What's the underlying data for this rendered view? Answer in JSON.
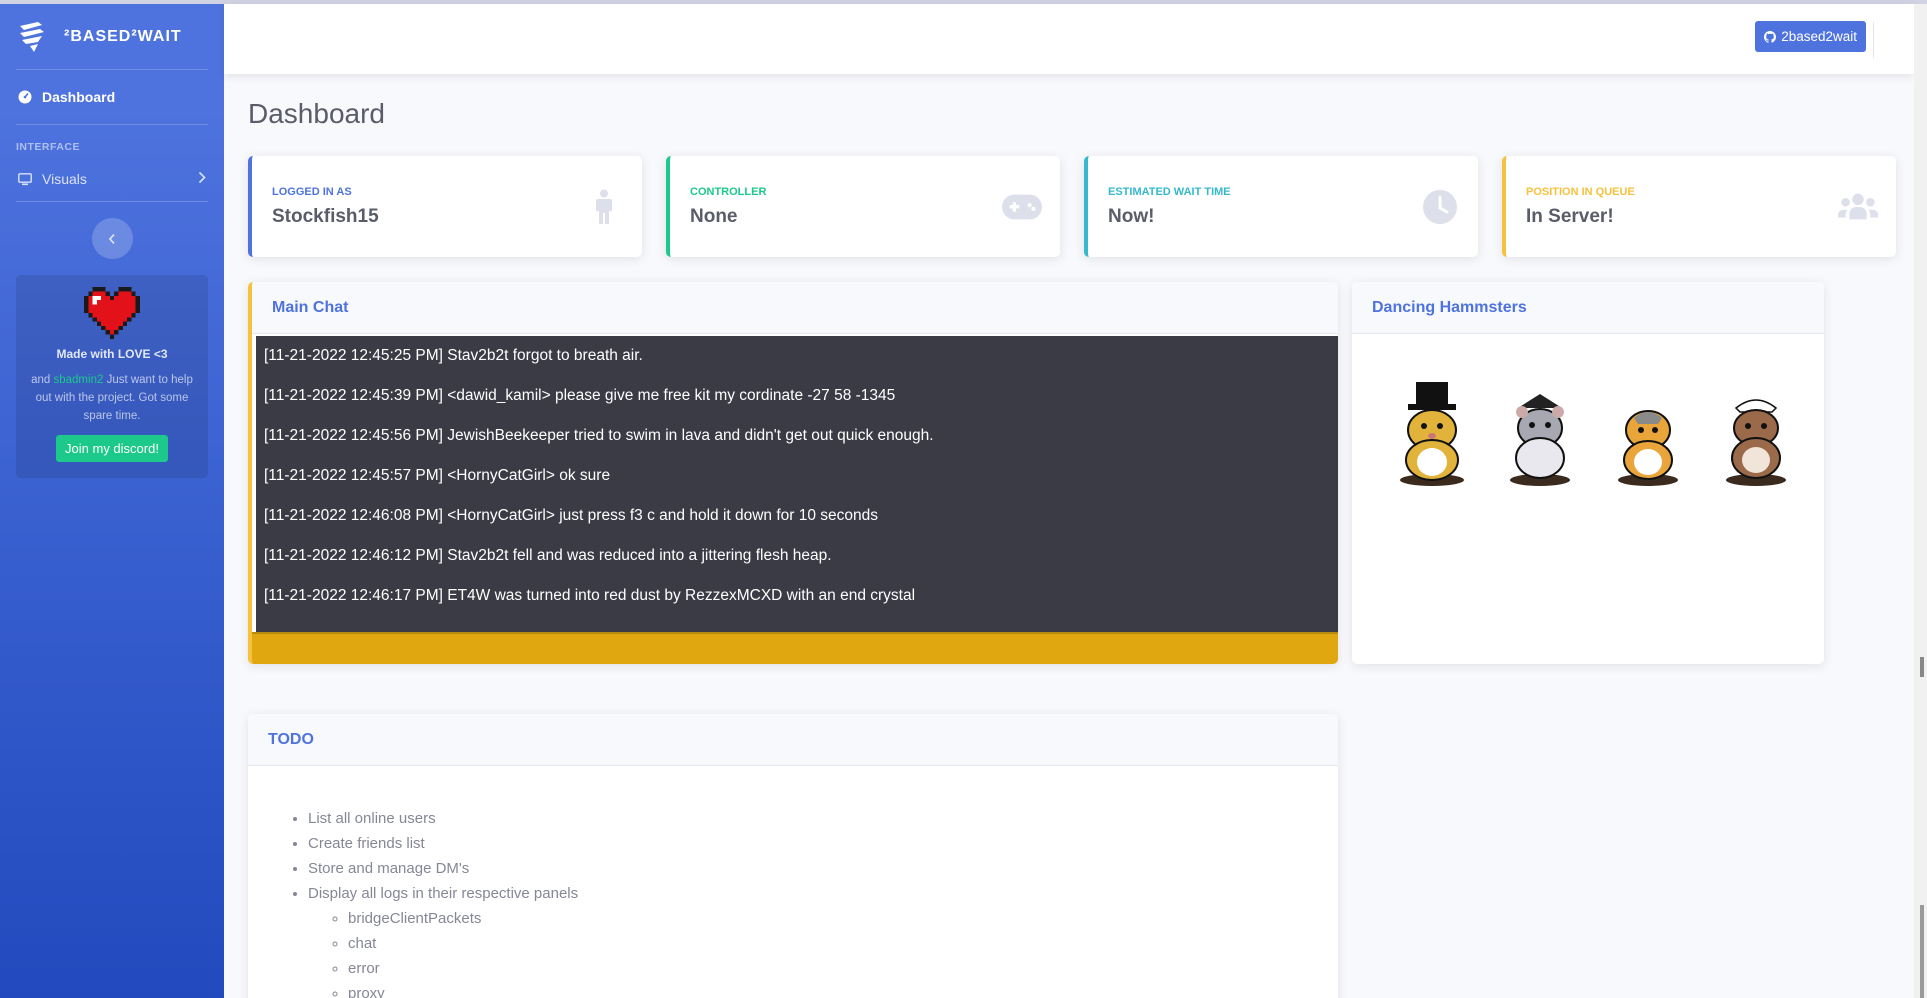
{
  "sidebar": {
    "brand": "²BASED²WAIT",
    "dashboard_label": "Dashboard",
    "heading_interface": "INTERFACE",
    "visuals_label": "Visuals",
    "promo": {
      "title": "Made with LOVE <3",
      "text_before": "and ",
      "author": "sbadmin2",
      "text_after": " Just want to help out with the project. Got some spare time.",
      "button": "Join my discord!"
    }
  },
  "topbar": {
    "github_button": "2based2wait"
  },
  "page_title": "Dashboard",
  "stats": [
    {
      "label": "LOGGED IN AS",
      "value": "Stockfish15",
      "color": "#4e73df",
      "icon": "person-icon"
    },
    {
      "label": "CONTROLLER",
      "value": "None",
      "color": "#1cc88a",
      "icon": "gamepad-icon"
    },
    {
      "label": "ESTIMATED WAIT TIME",
      "value": "Now!",
      "color": "#36b9cc",
      "icon": "clock-icon"
    },
    {
      "label": "POSITION IN QUEUE",
      "value": "In Server!",
      "color": "#f6c23e",
      "icon": "users-icon"
    }
  ],
  "chat": {
    "title": "Main Chat",
    "lines": [
      "[11-21-2022 12:45:25 PM] Stav2b2t forgot to breath air.",
      "[11-21-2022 12:45:39 PM] <dawid_kamil> please give me free kit my cordinate -27 58 -1345",
      "[11-21-2022 12:45:56 PM] JewishBeekeeper tried to swim in lava and didn't get out quick enough.",
      "[11-21-2022 12:45:57 PM] <HornyCatGirl> ok sure",
      "[11-21-2022 12:46:08 PM] <HornyCatGirl> just press f3 c and hold it down for 10 seconds",
      "[11-21-2022 12:46:12 PM] Stav2b2t fell and was reduced into a jittering flesh heap.",
      "[11-21-2022 12:46:17 PM] ET4W was turned into red dust by RezzexMCXD with an end crystal"
    ]
  },
  "hamsters": {
    "title": "Dancing Hammsters"
  },
  "todo": {
    "title": "TODO",
    "items": [
      "List all online users",
      "Create friends list",
      "Store and manage DM's",
      "Display all logs in their respective panels"
    ],
    "subitems": [
      "bridgeClientPackets",
      "chat",
      "error",
      "proxy"
    ]
  },
  "colors": {
    "primary": "#4e73df",
    "success": "#1cc88a",
    "info": "#36b9cc",
    "warning": "#f6c23e"
  }
}
